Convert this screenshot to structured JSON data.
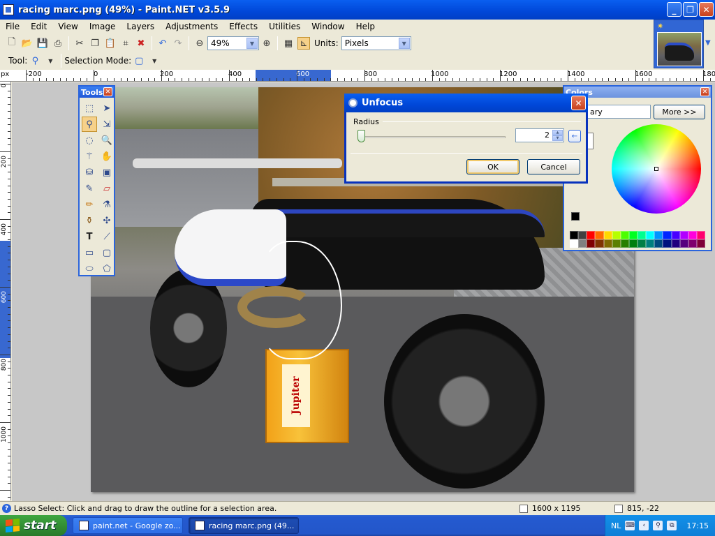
{
  "window": {
    "title": "racing marc.png (49%) - Paint.NET v3.5.9",
    "buttons": [
      "_",
      "❐",
      "✕"
    ]
  },
  "menu": [
    "File",
    "Edit",
    "View",
    "Image",
    "Layers",
    "Adjustments",
    "Effects",
    "Utilities",
    "Window",
    "Help"
  ],
  "toolbar": {
    "zoom_value": "49%",
    "units_label": "Units:",
    "units_value": "Pixels"
  },
  "toolbar2": {
    "tool_label": "Tool:",
    "selection_mode_label": "Selection Mode:"
  },
  "ruler": {
    "unit": "px",
    "h_labels": [
      "-200",
      "0",
      "200",
      "400",
      "600",
      "800",
      "1000",
      "1200",
      "1400",
      "1600",
      "180"
    ],
    "v_labels": [
      "0",
      "200",
      "400",
      "600",
      "800",
      "1000"
    ]
  },
  "tools_panel": {
    "title": "Tools",
    "close": "✕",
    "tool_icons": [
      "rectangle-select-icon",
      "move-selection-icon",
      "lasso-select-icon",
      "move-selection-mode-icon",
      "ellipse-select-icon",
      "zoom-icon",
      "magic-wand-icon",
      "pan-icon",
      "paint-bucket-icon",
      "gradient-icon",
      "paintbrush-icon",
      "eraser-icon",
      "pencil-icon",
      "color-picker-icon",
      "clone-stamp-icon",
      "recolor-icon",
      "text-icon",
      "line-curve-icon",
      "rectangle-icon",
      "rounded-rectangle-icon",
      "ellipse-icon",
      "freeform-shape-icon"
    ]
  },
  "colors_panel": {
    "title": "Colors",
    "close": "✕",
    "selector_text": "ary",
    "more_button": "More >>",
    "primary_color": "#000000",
    "secondary_color": "#ffffff",
    "palette": [
      "#000000",
      "#404040",
      "#ff0000",
      "#ff6a00",
      "#ffd800",
      "#b6ff00",
      "#4cff00",
      "#00ff21",
      "#00ff90",
      "#00ffff",
      "#0094ff",
      "#0026ff",
      "#4800ff",
      "#b200ff",
      "#ff00dc",
      "#ff006e",
      "#ffffff",
      "#808080",
      "#7f0000",
      "#7f3300",
      "#7f6a00",
      "#5b7f00",
      "#267f00",
      "#007f0e",
      "#007f46",
      "#007f7f",
      "#004a7f",
      "#00137f",
      "#21007f",
      "#57007f",
      "#7f006e",
      "#7f0037"
    ]
  },
  "dialog": {
    "title": "Unfocus",
    "close": "✕",
    "radius_label": "Radius",
    "radius_value": "2",
    "reset_icon": "←",
    "ok": "OK",
    "cancel": "Cancel"
  },
  "image": {
    "crate_text": "Jupiter"
  },
  "status": {
    "hint": "Lasso Select: Click and drag to draw the outline for a selection area.",
    "image_size": "1600 x 1195",
    "cursor_pos": "815, -22"
  },
  "taskbar": {
    "start": "start",
    "tasks": [
      "paint.net - Google zo...",
      "racing marc.png (49..."
    ],
    "lang": "NL",
    "time": "17:15"
  }
}
